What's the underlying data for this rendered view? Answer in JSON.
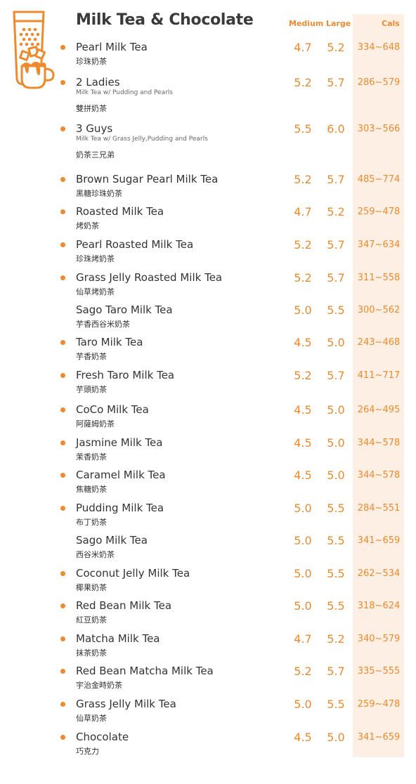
{
  "header": {
    "title": "Milk Tea & Chocolate",
    "col_medium": "Medium",
    "col_large": "Large",
    "col_cals": "Cals"
  },
  "colors": {
    "accent": "#ef8a2c",
    "cals_band": "#fdefe3",
    "text": "#333333"
  },
  "logo_icon": "milk-tea-cup-icon",
  "items": [
    {
      "name": "Pearl Milk Tea",
      "sub": "",
      "zh": "珍珠奶茶",
      "medium": "4.7",
      "large": "5.2",
      "cals": "334~648",
      "bullet": true
    },
    {
      "name": "2 Ladies",
      "sub": "Milk Tea w/ Pudding and Pearls",
      "zh": "雙拼奶茶",
      "medium": "5.2",
      "large": "5.7",
      "cals": "286~579",
      "bullet": true
    },
    {
      "name": "3 Guys",
      "sub": "Milk Tea w/ Grass Jelly,Pudding and Pearls",
      "zh": "奶茶三兄弟",
      "medium": "5.5",
      "large": "6.0",
      "cals": "303~566",
      "bullet": true
    },
    {
      "name": "Brown Sugar Pearl Milk Tea",
      "sub": "",
      "zh": "黑糖珍珠奶茶",
      "medium": "5.2",
      "large": "5.7",
      "cals": "485~774",
      "bullet": true
    },
    {
      "name": "Roasted Milk Tea",
      "sub": "",
      "zh": "烤奶茶",
      "medium": "4.7",
      "large": "5.2",
      "cals": "259~478",
      "bullet": true
    },
    {
      "name": "Pearl Roasted Milk Tea",
      "sub": "",
      "zh": "珍珠烤奶茶",
      "medium": "5.2",
      "large": "5.7",
      "cals": "347~634",
      "bullet": true
    },
    {
      "name": "Grass Jelly  Roasted Milk Tea",
      "sub": "",
      "zh": "仙草烤奶茶",
      "medium": "5.2",
      "large": "5.7",
      "cals": "311~558",
      "bullet": true
    },
    {
      "name": "Sago Taro Milk Tea",
      "sub": "",
      "zh": "芋香西谷米奶茶",
      "medium": "5.0",
      "large": "5.5",
      "cals": "300~562",
      "bullet": false
    },
    {
      "name": "Taro Milk Tea",
      "sub": "",
      "zh": "芋香奶茶",
      "medium": "4.5",
      "large": "5.0",
      "cals": "243~468",
      "bullet": true
    },
    {
      "name": "Fresh Taro Milk Tea",
      "sub": "",
      "zh": "芋頭奶茶",
      "medium": "5.2",
      "large": "5.7",
      "cals": "411~717",
      "bullet": true
    },
    {
      "name": "CoCo Milk Tea",
      "sub": "",
      "zh": "阿薩姆奶茶",
      "medium": "4.5",
      "large": "5.0",
      "cals": "264~495",
      "bullet": true
    },
    {
      "name": "Jasmine Milk Tea",
      "sub": "",
      "zh": "茉香奶茶",
      "medium": "4.5",
      "large": "5.0",
      "cals": "344~578",
      "bullet": true
    },
    {
      "name": "Caramel Milk Tea",
      "sub": "",
      "zh": "焦糖奶茶",
      "medium": "4.5",
      "large": "5.0",
      "cals": "344~578",
      "bullet": true
    },
    {
      "name": "Pudding Milk Tea",
      "sub": "",
      "zh": "布丁奶茶",
      "medium": "5.0",
      "large": "5.5",
      "cals": "284~551",
      "bullet": true
    },
    {
      "name": "Sago Milk Tea",
      "sub": "",
      "zh": "西谷米奶茶",
      "medium": "5.0",
      "large": "5.5",
      "cals": "341~659",
      "bullet": false
    },
    {
      "name": "Coconut Jelly Milk Tea",
      "sub": "",
      "zh": "椰果奶茶",
      "medium": "5.0",
      "large": "5.5",
      "cals": "262~534",
      "bullet": true
    },
    {
      "name": "Red Bean Milk Tea",
      "sub": "",
      "zh": "紅豆奶茶",
      "medium": "5.0",
      "large": "5.5",
      "cals": "318~624",
      "bullet": true
    },
    {
      "name": "Matcha Milk Tea",
      "sub": "",
      "zh": "抹茶奶茶",
      "medium": "4.7",
      "large": "5.2",
      "cals": "340~579",
      "bullet": true
    },
    {
      "name": "Red Bean Matcha Milk Tea",
      "sub": "",
      "zh": "宇治金時奶茶",
      "medium": "5.2",
      "large": "5.7",
      "cals": "335~555",
      "bullet": true
    },
    {
      "name": "Grass Jelly Milk Tea",
      "sub": "",
      "zh": "仙草奶茶",
      "medium": "5.0",
      "large": "5.5",
      "cals": "259~478",
      "bullet": true
    },
    {
      "name": "Chocolate",
      "sub": "",
      "zh": "巧克力",
      "medium": "4.5",
      "large": "5.0",
      "cals": "341~659",
      "bullet": true
    }
  ]
}
